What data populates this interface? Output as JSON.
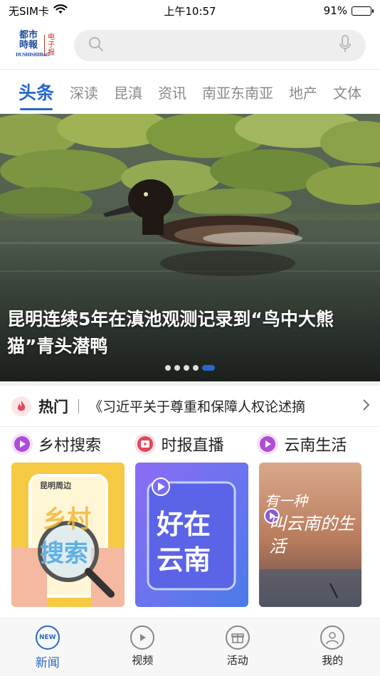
{
  "status_bar": {
    "carrier": "无SIM卡",
    "time": "上午10:57",
    "battery_percent_text": "91%",
    "battery_level": 0.91
  },
  "header": {
    "logo_main": "都市時報",
    "logo_sub": "DUSHISHIBAO",
    "logo_side": "电子报",
    "search_placeholder": ""
  },
  "tabs": [
    {
      "label": "头条",
      "active": true
    },
    {
      "label": "深读",
      "active": false
    },
    {
      "label": "昆滇",
      "active": false
    },
    {
      "label": "资讯",
      "active": false
    },
    {
      "label": "南亚东南亚",
      "active": false
    },
    {
      "label": "地产",
      "active": false
    },
    {
      "label": "文体",
      "active": false
    }
  ],
  "hero": {
    "title": "昆明连续5年在滇池观测记录到“鸟中大熊猫”青头潜鸭",
    "slide_count": 5,
    "active_slide": 5
  },
  "hot": {
    "label": "热门",
    "headline": "《习近平关于尊重和保障人权论述摘"
  },
  "channels": [
    {
      "label": "乡村搜索",
      "icon": "play-icon",
      "color": "#b04cd8"
    },
    {
      "label": "时报直播",
      "icon": "video-icon",
      "color": "#e2485d"
    },
    {
      "label": "云南生活",
      "icon": "play-icon",
      "color": "#b04cd8"
    }
  ],
  "cards": [
    {
      "caption_small": "昆明周边",
      "caption_big_1": "乡村",
      "caption_big_2": "搜索"
    },
    {
      "caption_big_1": "好在",
      "caption_big_2": "云南"
    },
    {
      "caption_big_1": "有一种",
      "caption_big_2": "叫云南的生活"
    }
  ],
  "bottom_nav": [
    {
      "label": "新闻",
      "icon": "news-icon",
      "icon_text": "NEW",
      "active": true
    },
    {
      "label": "视频",
      "icon": "video-play-icon",
      "active": false
    },
    {
      "label": "活动",
      "icon": "gift-icon",
      "active": false
    },
    {
      "label": "我的",
      "icon": "user-icon",
      "active": false
    }
  ],
  "colors": {
    "accent": "#2a68c8",
    "hot_red": "#e2485d",
    "brand_blue": "#1f4e9e"
  }
}
